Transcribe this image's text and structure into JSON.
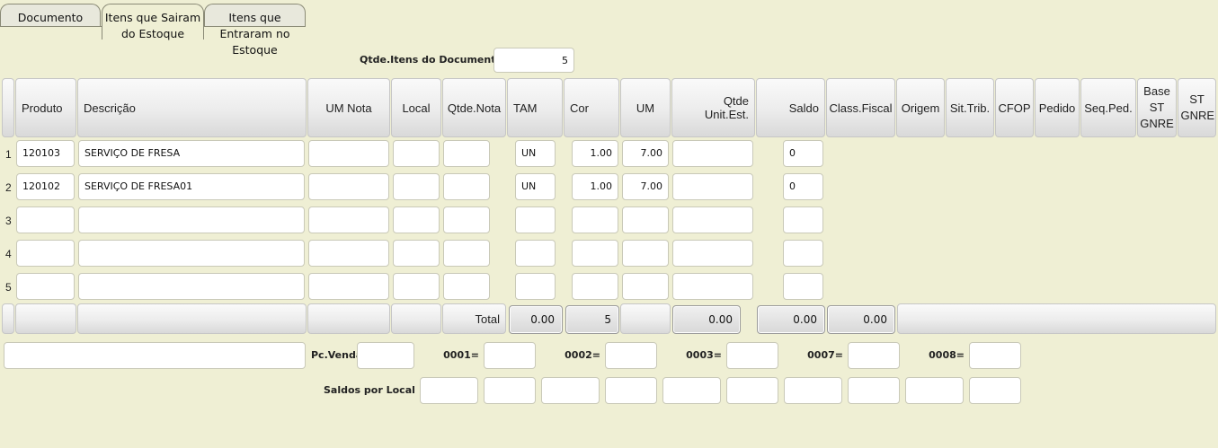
{
  "tabs": [
    {
      "label": "Documento"
    },
    {
      "label": "Itens que Sairam do Estoque"
    },
    {
      "label": "Itens que Entraram no Estoque"
    }
  ],
  "qtde_itens": {
    "label": "Qtde.Itens do Documento",
    "value": "5"
  },
  "columns": {
    "produto": "Produto",
    "descricao": "Descrição",
    "um_nota": "UM Nota",
    "local": "Local",
    "qtde_nota": "Qtde.Nota",
    "tam": "TAM",
    "cor": "Cor",
    "um": "UM",
    "qtde_unit_est": "Qtde Unit.Est.",
    "saldo": "Saldo",
    "class_fiscal": "Class.Fiscal",
    "origem": "Origem",
    "sit_trib": "Sit.Trib.",
    "cfop": "CFOP",
    "pedido": "Pedido",
    "seq_ped": "Seq.Ped.",
    "base_st_gnre": "Base ST GNRE",
    "st_gnre": "ST GNRE"
  },
  "rows": [
    {
      "num": "1",
      "produto": "120103",
      "descricao": "SERVIÇO DE FRESA",
      "um_nota": "",
      "local": "",
      "qtde_nota": "",
      "tam": "UN",
      "cor": "1.00",
      "um": "7.00",
      "qtde_unit_est": "",
      "saldo": "0"
    },
    {
      "num": "2",
      "produto": "120102",
      "descricao": "SERVIÇO DE FRESA01",
      "um_nota": "",
      "local": "",
      "qtde_nota": "",
      "tam": "UN",
      "cor": "1.00",
      "um": "7.00",
      "qtde_unit_est": "",
      "saldo": "0"
    },
    {
      "num": "3",
      "produto": "",
      "descricao": "",
      "um_nota": "",
      "local": "",
      "qtde_nota": "",
      "tam": "",
      "cor": "",
      "um": "",
      "qtde_unit_est": "",
      "saldo": ""
    },
    {
      "num": "4",
      "produto": "",
      "descricao": "",
      "um_nota": "",
      "local": "",
      "qtde_nota": "",
      "tam": "",
      "cor": "",
      "um": "",
      "qtde_unit_est": "",
      "saldo": ""
    },
    {
      "num": "5",
      "produto": "",
      "descricao": "",
      "um_nota": "",
      "local": "",
      "qtde_nota": "",
      "tam": "",
      "cor": "",
      "um": "",
      "qtde_unit_est": "",
      "saldo": ""
    }
  ],
  "totals": {
    "label": "Total",
    "tam": "0.00",
    "cor": "5",
    "qtde_unit_est": "0.00",
    "saldo": "0.00",
    "class_fiscal": "0.00"
  },
  "footer": {
    "pc_venda_label": "Pc.Venda",
    "labels": [
      "0001=",
      "0002=",
      "0003=",
      "0007=",
      "0008="
    ],
    "saldos_label": "Saldos por Local"
  }
}
